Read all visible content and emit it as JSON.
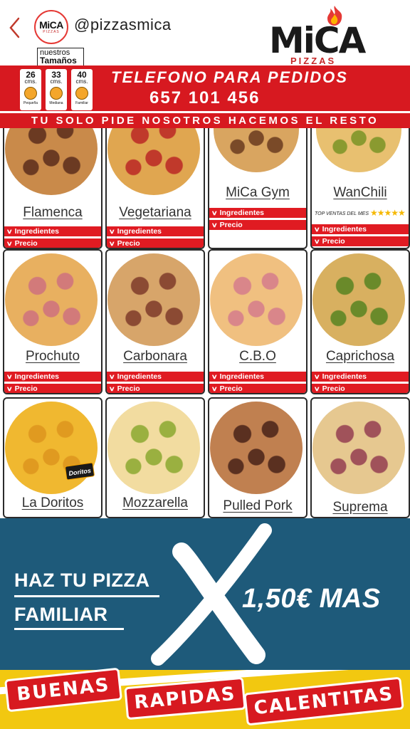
{
  "header": {
    "handle": "@pizzasmica",
    "avatar_logo": "MiCA",
    "avatar_sub": "PIZZAS",
    "sizes_line1": "nuestros",
    "sizes_line2": "Tamaños",
    "brand_word": "MiCA",
    "brand_sub": "PIZZAS"
  },
  "sizes": [
    {
      "num": "26",
      "unit": "cms.",
      "label": "Pequeña"
    },
    {
      "num": "33",
      "unit": "cms.",
      "label": "Mediana"
    },
    {
      "num": "40",
      "unit": "cms.",
      "label": "Familiar"
    }
  ],
  "banner": {
    "title": "TELEFONO PARA PEDIDOS",
    "phone": "657 101 456",
    "slogan": "TU SOLO PIDE NOSOTROS HACEMOS EL RESTO"
  },
  "buttons": {
    "ingredients": "Ingredientes",
    "price": "Precio"
  },
  "pizzas": [
    {
      "name": "Flamenca",
      "base": "#c98a4a",
      "top": "#6b3a22"
    },
    {
      "name": "Vegetariana",
      "base": "#e0a650",
      "top": "#c0392b"
    },
    {
      "name": "MiCa Gym",
      "base": "#d9a560",
      "top": "#7a4a28"
    },
    {
      "name": "WanChili",
      "base": "#e8c070",
      "top": "#8a9a30"
    },
    {
      "name": "Prochuto",
      "base": "#e8b060",
      "top": "#d27a7a"
    },
    {
      "name": "Carbonara",
      "base": "#d7a56a",
      "top": "#8b4a33"
    },
    {
      "name": "C.B.O",
      "base": "#f0c080",
      "top": "#d9868a"
    },
    {
      "name": "Caprichosa",
      "base": "#d8b060",
      "top": "#6a8a2a"
    },
    {
      "name": "La Doritos",
      "base": "#f0b830",
      "top": "#e09a20"
    },
    {
      "name": "Mozzarella",
      "base": "#f2dca0",
      "top": "#9ab040"
    },
    {
      "name": "Pulled Pork",
      "base": "#c08050",
      "top": "#5a3020"
    },
    {
      "name": "Suprema",
      "base": "#e6c890",
      "top": "#a0525a"
    }
  ],
  "rating": {
    "text": "TOP VENTAS DEL MES",
    "stars": 5,
    "stars_text": "★★★★★"
  },
  "doritos_tag": "Doritos",
  "promo": {
    "line1": "HAZ TU PIZZA",
    "line2": "FAMILIAR",
    "price": "1,50€ MAS"
  },
  "footer": {
    "words": [
      "BUENAS",
      "RAPIDAS",
      "CALENTITAS"
    ]
  },
  "colors": {
    "brand_red": "#d71920",
    "promo_blue": "#1e5a7a",
    "footer_yellow": "#f2c810"
  }
}
